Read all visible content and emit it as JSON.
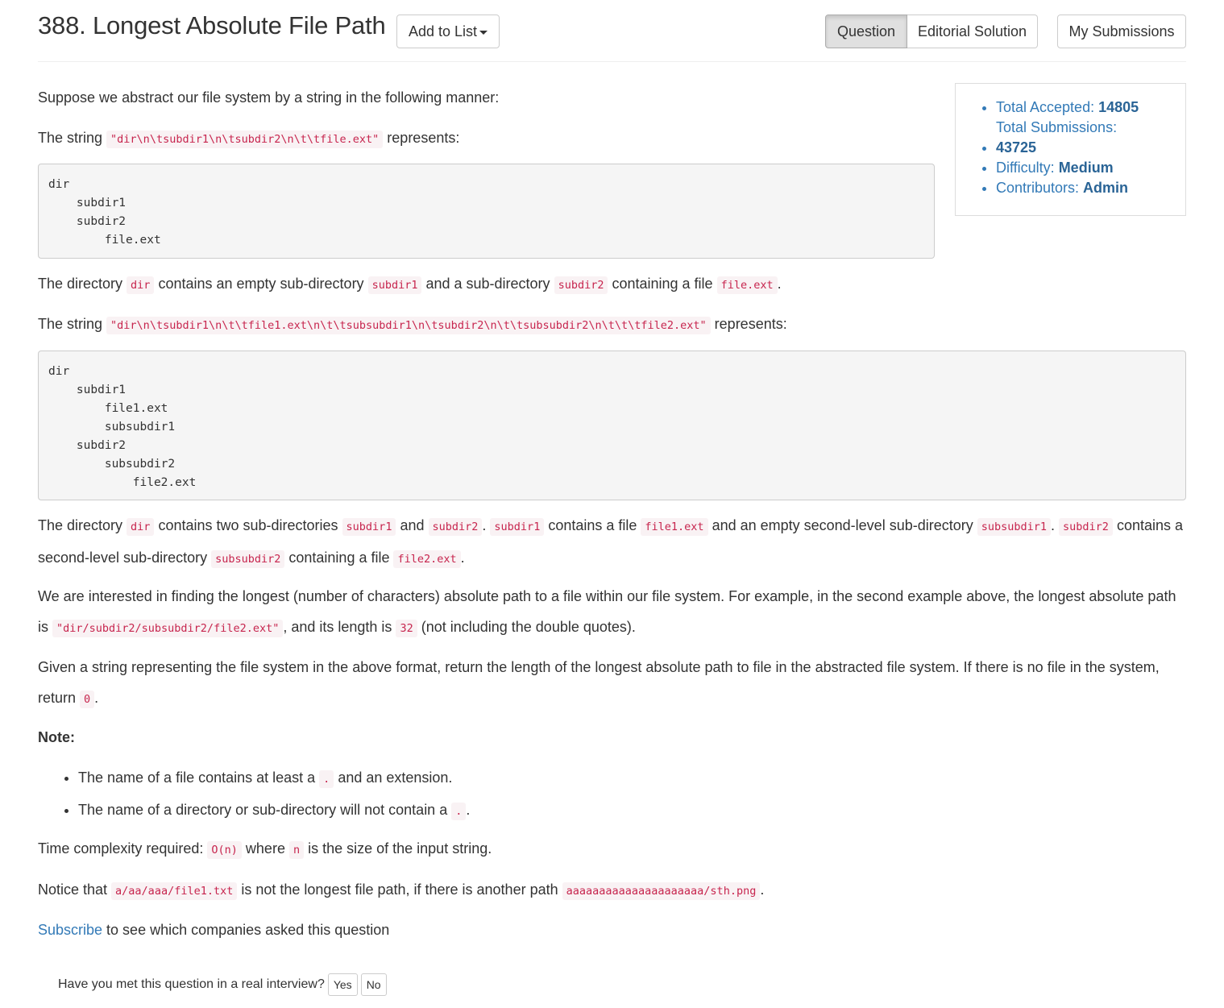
{
  "header": {
    "title": "388. Longest Absolute File Path",
    "add_to_list": "Add to List",
    "tab_question": "Question",
    "tab_editorial": "Editorial Solution",
    "my_submissions": "My Submissions"
  },
  "stats": {
    "accepted_label": "Total Accepted: ",
    "accepted_value": "14805",
    "submissions_label": "Total Submissions: ",
    "submissions_value": "43725",
    "difficulty_label": "Difficulty: ",
    "difficulty_value": "Medium",
    "contributors_label": "Contributors: ",
    "contributors_value": "Admin"
  },
  "body": {
    "intro": "Suppose we abstract our file system by a string in the following manner:",
    "p1_a": "The string ",
    "p1_code": "\"dir\\n\\tsubdir1\\n\\tsubdir2\\n\\t\\tfile.ext\"",
    "p1_b": " represents:",
    "pre1": "dir\n    subdir1\n    subdir2\n        file.ext",
    "p2_a": "The directory ",
    "p2_c1": "dir",
    "p2_b": " contains an empty sub-directory ",
    "p2_c2": "subdir1",
    "p2_c": " and a sub-directory ",
    "p2_c3": "subdir2",
    "p2_d": " containing a file ",
    "p2_c4": "file.ext",
    "p2_e": ".",
    "p3_a": "The string ",
    "p3_code": "\"dir\\n\\tsubdir1\\n\\t\\tfile1.ext\\n\\t\\tsubsubdir1\\n\\tsubdir2\\n\\t\\tsubsubdir2\\n\\t\\t\\tfile2.ext\"",
    "p3_b": " represents:",
    "pre2": "dir\n    subdir1\n        file1.ext\n        subsubdir1\n    subdir2\n        subsubdir2\n            file2.ext",
    "p4_a": "The directory ",
    "p4_c1": "dir",
    "p4_b": " contains two sub-directories ",
    "p4_c2": "subdir1",
    "p4_c": " and ",
    "p4_c3": "subdir2",
    "p4_d": ". ",
    "p4_c4": "subdir1",
    "p4_e": " contains a file ",
    "p4_c5": "file1.ext",
    "p4_f": " and an empty second-level sub-directory ",
    "p4_c6": "subsubdir1",
    "p4_g": ". ",
    "p4_c7": "subdir2",
    "p4_h": " contains a second-level sub-directory ",
    "p4_c8": "subsubdir2",
    "p4_i": " containing a file ",
    "p4_c9": "file2.ext",
    "p4_j": ".",
    "p5_a": "We are interested in finding the longest (number of characters) absolute path to a file within our file system. For example, in the second example above, the longest absolute path is ",
    "p5_c1": "\"dir/subdir2/subsubdir2/file2.ext\"",
    "p5_b": ", and its length is ",
    "p5_c2": "32",
    "p5_c": " (not including the double quotes).",
    "p6_a": "Given a string representing the file system in the above format, return the length of the longest absolute path to file in the abstracted file system. If there is no file in the system, return ",
    "p6_c1": "0",
    "p6_b": ".",
    "note_heading": "Note:",
    "note1_a": "The name of a file contains at least a ",
    "note1_c": ".",
    "note1_b": " and an extension.",
    "note2_a": "The name of a directory or sub-directory will not contain a ",
    "note2_c": ".",
    "note2_b": ".",
    "p7_a": "Time complexity required: ",
    "p7_c1": "O(n)",
    "p7_b": " where ",
    "p7_c2": "n",
    "p7_c": " is the size of the input string.",
    "p8_a": "Notice that ",
    "p8_c1": "a/aa/aaa/file1.txt",
    "p8_b": " is not the longest file path, if there is another path ",
    "p8_c2": "aaaaaaaaaaaaaaaaaaaaa/sth.png",
    "p8_c": ".",
    "subscribe_link": "Subscribe",
    "subscribe_rest": " to see which companies asked this question"
  },
  "interview": {
    "question": "Have you met this question in a real interview?",
    "yes": "Yes",
    "no": "No"
  }
}
